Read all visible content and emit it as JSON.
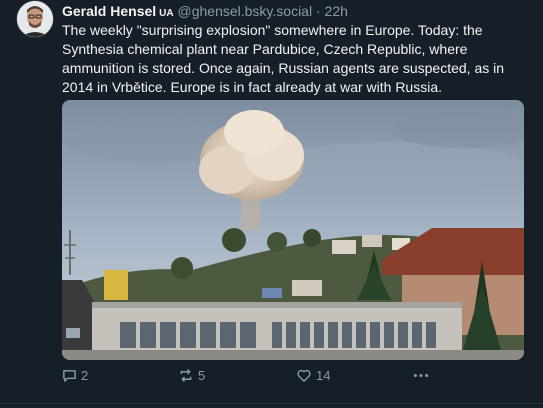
{
  "post": {
    "author_name": "Gerald Hensel",
    "author_badge": "UA",
    "handle": "@ghensel.bsky.social",
    "separator": "·",
    "timestamp": "22h",
    "text": "The weekly \"surprising explosion\" somewhere in Europe. Today: the Synthesia chemical plant near Pardubice, Czech Republic, where ammunition is stored. Once again, Russian agents are suspected, as in 2014 in Vrbětice. Europe is in fact already at war with Russia.",
    "image_icon": "photo-explosion-smoke-over-town"
  },
  "actions": {
    "replies": "2",
    "reposts": "5",
    "likes": "14",
    "more_icon": "ellipsis-icon"
  },
  "colors": {
    "background": "#161e27",
    "text": "#f1f3f5",
    "muted": "#8c9aab"
  }
}
